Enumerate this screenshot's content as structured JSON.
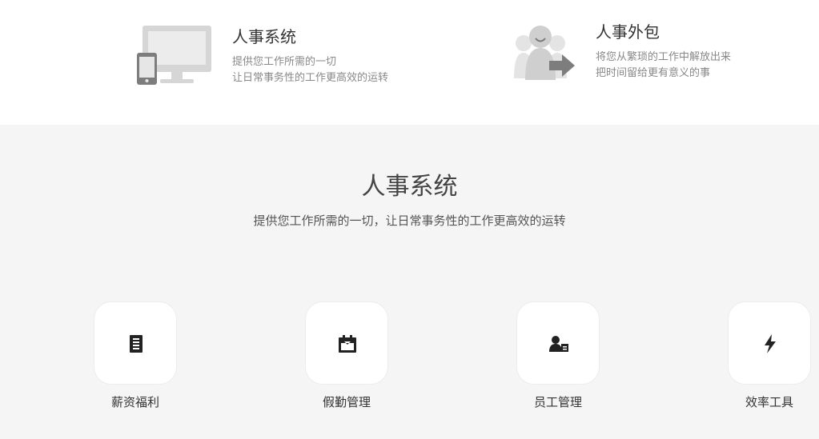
{
  "features": [
    {
      "title": "人事系统",
      "lines": [
        "提供您工作所需的一切",
        "让日常事务性的工作更高效的运转"
      ],
      "icon": "monitor-phone-icon"
    },
    {
      "title": "人事外包",
      "lines": [
        "将您从繁琐的工作中解放出来",
        "把时间留给更有意义的事"
      ],
      "icon": "people-arrow-icon"
    }
  ],
  "section": {
    "title": "人事系统",
    "subtitle": "提供您工作所需的一切，让日常事务性的工作更高效的运转"
  },
  "cards": [
    {
      "label": "薪资福利",
      "icon": "document-list-icon"
    },
    {
      "label": "假勤管理",
      "icon": "calendar-icon"
    },
    {
      "label": "员工管理",
      "icon": "user-card-icon"
    },
    {
      "label": "效率工具",
      "icon": "lightning-icon"
    }
  ],
  "colors": {
    "top_bg": "#ffffff",
    "section_bg": "#f5f5f5",
    "illustration_gray": "#d6d6d6",
    "icon_dark": "#222222"
  }
}
